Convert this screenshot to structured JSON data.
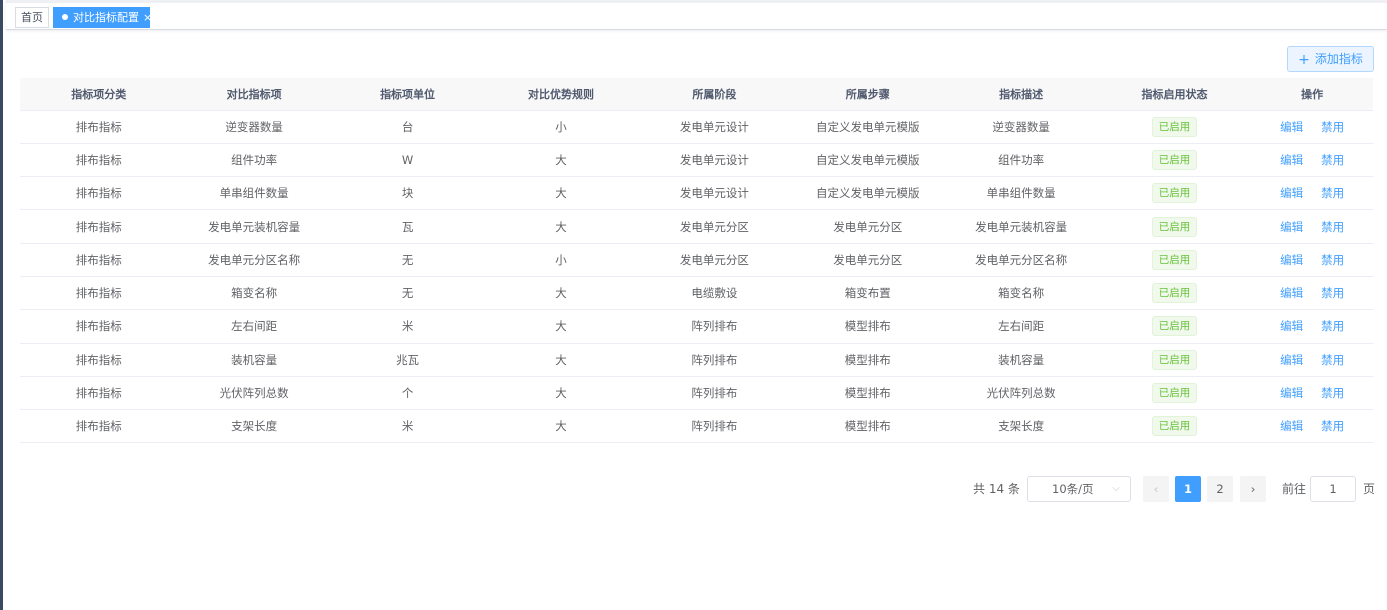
{
  "tags": {
    "home": "首页",
    "active": "对比指标配置",
    "close_glyph": "×"
  },
  "toolbar": {
    "add_label": "添加指标",
    "add_icon": "plus-icon"
  },
  "table": {
    "columns": [
      "指标项分类",
      "对比指标项",
      "指标项单位",
      "对比优势规则",
      "所属阶段",
      "所属步骤",
      "指标描述",
      "指标启用状态",
      "操作"
    ],
    "rows": [
      {
        "category": "排布指标",
        "item": "逆变器数量",
        "unit": "台",
        "rule": "小",
        "stage": "发电单元设计",
        "step": "自定义发电单元模版",
        "desc": "逆变器数量",
        "status": "已启用"
      },
      {
        "category": "排布指标",
        "item": "组件功率",
        "unit": "W",
        "rule": "大",
        "stage": "发电单元设计",
        "step": "自定义发电单元模版",
        "desc": "组件功率",
        "status": "已启用"
      },
      {
        "category": "排布指标",
        "item": "单串组件数量",
        "unit": "块",
        "rule": "大",
        "stage": "发电单元设计",
        "step": "自定义发电单元模版",
        "desc": "单串组件数量",
        "status": "已启用"
      },
      {
        "category": "排布指标",
        "item": "发电单元装机容量",
        "unit": "瓦",
        "rule": "大",
        "stage": "发电单元分区",
        "step": "发电单元分区",
        "desc": "发电单元装机容量",
        "status": "已启用"
      },
      {
        "category": "排布指标",
        "item": "发电单元分区名称",
        "unit": "无",
        "rule": "小",
        "stage": "发电单元分区",
        "step": "发电单元分区",
        "desc": "发电单元分区名称",
        "status": "已启用"
      },
      {
        "category": "排布指标",
        "item": "箱变名称",
        "unit": "无",
        "rule": "大",
        "stage": "电缆敷设",
        "step": "箱变布置",
        "desc": "箱变名称",
        "status": "已启用"
      },
      {
        "category": "排布指标",
        "item": "左右间距",
        "unit": "米",
        "rule": "大",
        "stage": "阵列排布",
        "step": "模型排布",
        "desc": "左右间距",
        "status": "已启用"
      },
      {
        "category": "排布指标",
        "item": "装机容量",
        "unit": "兆瓦",
        "rule": "大",
        "stage": "阵列排布",
        "step": "模型排布",
        "desc": "装机容量",
        "status": "已启用"
      },
      {
        "category": "排布指标",
        "item": "光伏阵列总数",
        "unit": "个",
        "rule": "大",
        "stage": "阵列排布",
        "step": "模型排布",
        "desc": "光伏阵列总数",
        "status": "已启用"
      },
      {
        "category": "排布指标",
        "item": "支架长度",
        "unit": "米",
        "rule": "大",
        "stage": "阵列排布",
        "step": "模型排布",
        "desc": "支架长度",
        "status": "已启用"
      }
    ],
    "actions": {
      "edit": "编辑",
      "disable": "禁用"
    }
  },
  "pagination": {
    "total_text": "共 14 条",
    "page_size": "10条/页",
    "prev_glyph": "‹",
    "next_glyph": "›",
    "pages": [
      "1",
      "2"
    ],
    "current_page": "1",
    "goto_label": "前往",
    "goto_value": "1",
    "page_suffix": "页"
  },
  "colors": {
    "primary": "#409eff",
    "success": "#67c23a",
    "sidebar_edge": "#3b4a63"
  }
}
